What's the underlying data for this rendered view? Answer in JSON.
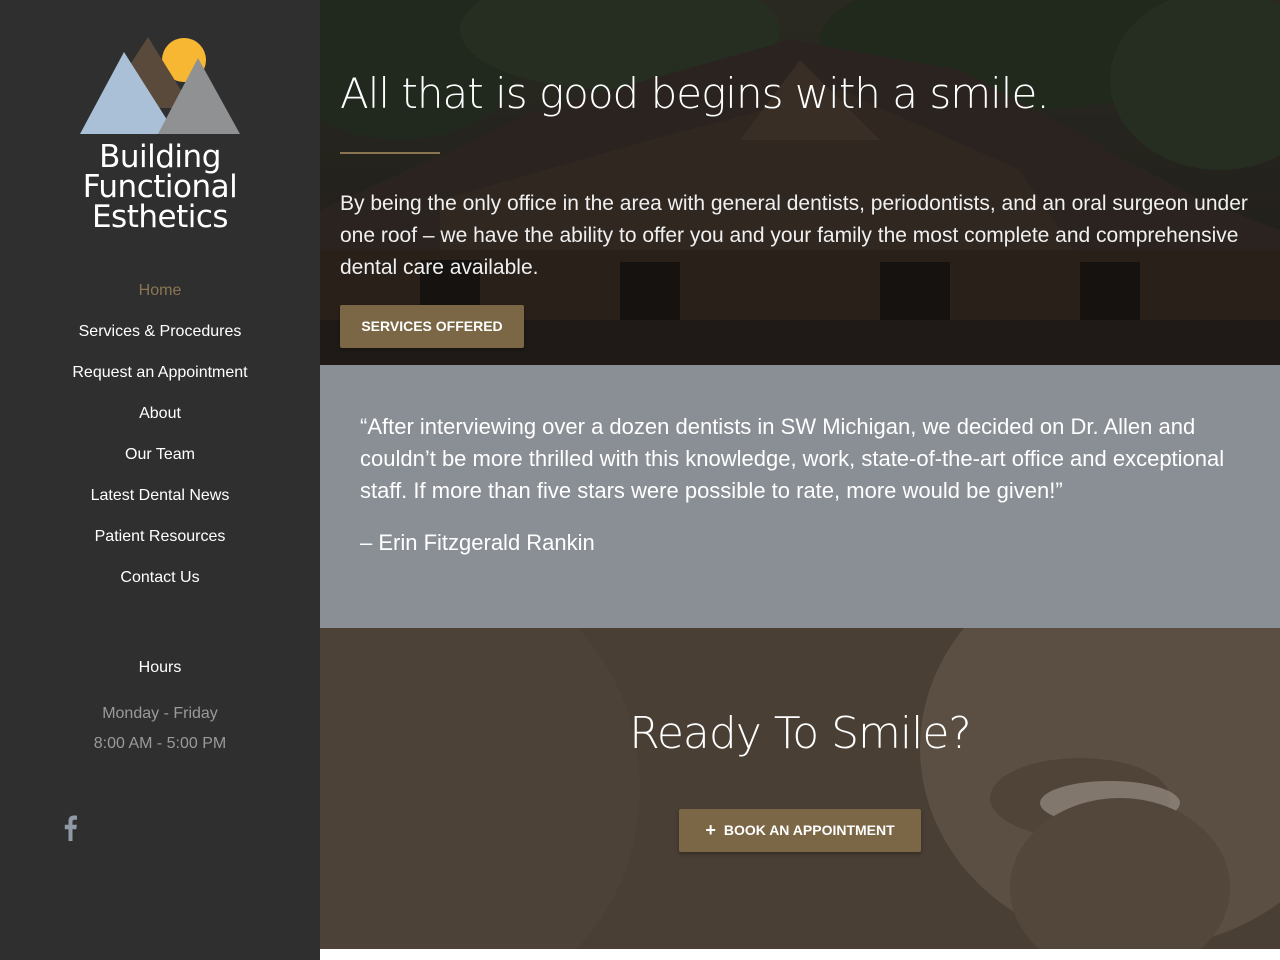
{
  "colors": {
    "sidebar_bg": "#2f2f2f",
    "accent": "#8a7652",
    "button": "#7b6746",
    "testimonial_bg": "#8a8f96",
    "logo_sun": "#f7b733",
    "logo_mountain_light": "#a9c0d6",
    "logo_mountain_dark": "#5a4a3c",
    "logo_mountain_grey": "#8f9193"
  },
  "sidebar": {
    "logo": {
      "line1": "Building",
      "line2": "Functional",
      "line3": "Esthetics",
      "icon": "mountains-sun-logo"
    },
    "nav": [
      {
        "label": "Home",
        "active": true
      },
      {
        "label": "Services & Procedures",
        "active": false
      },
      {
        "label": "Request an Appointment",
        "active": false
      },
      {
        "label": "About",
        "active": false
      },
      {
        "label": "Our Team",
        "active": false
      },
      {
        "label": "Latest Dental News",
        "active": false
      },
      {
        "label": "Patient Resources",
        "active": false
      },
      {
        "label": "Contact Us",
        "active": false
      }
    ],
    "hours": {
      "title": "Hours",
      "days": "Monday - Friday",
      "time": "8:00 AM - 5:00 PM"
    },
    "social": {
      "icon": "facebook-icon"
    }
  },
  "hero": {
    "title": "All that is good begins with a smile.",
    "text": "By being the only office in the area with general dentists, periodontists, and an oral surgeon under one roof – we have the ability to offer you and your family the most complete and comprehensive dental care available.",
    "button": "SERVICES OFFERED"
  },
  "testimonial": {
    "quote": "“After interviewing over a dozen dentists in SW Michigan, we decided on Dr. Allen and couldn’t be more thrilled with this knowledge, work, state-of-the-art office and exceptional staff. If more than five stars were possible to rate, more would be given!”",
    "author": "– Erin Fitzgerald Rankin"
  },
  "cta": {
    "title": "Ready To Smile?",
    "button": "BOOK AN APPOINTMENT",
    "button_icon": "plus-icon"
  }
}
